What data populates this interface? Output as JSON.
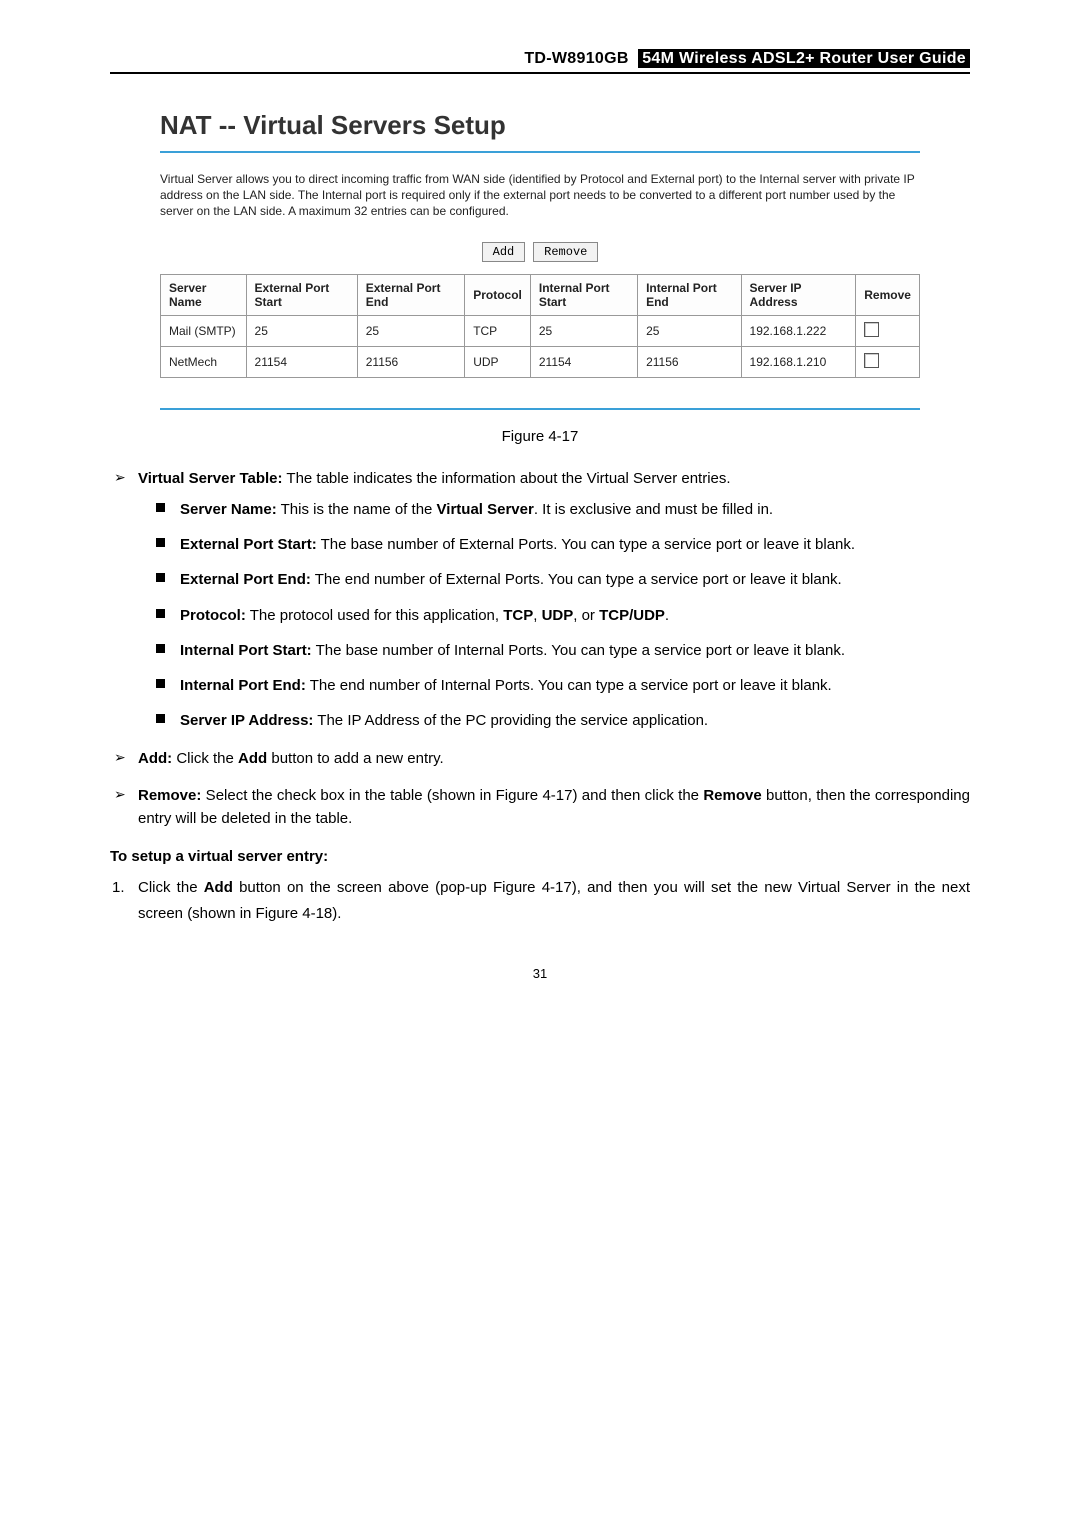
{
  "header": {
    "model": "TD-W8910GB",
    "title": "54M Wireless ADSL2+ Router User Guide"
  },
  "router": {
    "heading": "NAT -- Virtual Servers Setup",
    "description": "Virtual Server allows you to direct incoming traffic from WAN side (identified by Protocol and External port) to the Internal server with private IP address on the LAN side. The Internal port is required only if the external port needs to be converted to a different port number used by the server on the LAN side. A maximum 32 entries can be configured.",
    "buttons": {
      "add": "Add",
      "remove": "Remove"
    },
    "columns": {
      "c0": "Server Name",
      "c1": "External Port Start",
      "c2": "External Port End",
      "c3": "Protocol",
      "c4": "Internal Port Start",
      "c5": "Internal Port End",
      "c6": "Server IP Address",
      "c7": "Remove"
    },
    "rows": [
      {
        "c0": "Mail (SMTP)",
        "c1": "25",
        "c2": "25",
        "c3": "TCP",
        "c4": "25",
        "c5": "25",
        "c6": "192.168.1.222"
      },
      {
        "c0": "NetMech",
        "c1": "21154",
        "c2": "21156",
        "c3": "UDP",
        "c4": "21154",
        "c5": "21156",
        "c6": "192.168.1.210"
      }
    ]
  },
  "figure_caption": "Figure 4-17",
  "doc": {
    "vs_table_label": "Virtual Server Table:",
    "vs_table_text": " The table indicates the information about the Virtual Server entries.",
    "server_name_label": "Server Name:",
    "server_name_text_a": " This is the name of the ",
    "server_name_bold": "Virtual Server",
    "server_name_text_b": ". It is exclusive and must be filled in.",
    "ext_start_label": "External Port Start:",
    "ext_start_text": " The base number of External Ports. You can type a service port or leave it blank.",
    "ext_end_label": "External Port End:",
    "ext_end_text": " The end number of External Ports. You can type a service port or leave it blank.",
    "protocol_label": "Protocol:",
    "protocol_text_a": " The protocol used for this application, ",
    "protocol_tcp": "TCP",
    "protocol_sep1": ", ",
    "protocol_udp": "UDP",
    "protocol_sep2": ", or ",
    "protocol_both": "TCP/UDP",
    "protocol_end": ".",
    "int_start_label": "Internal Port Start:",
    "int_start_text": " The base number of Internal Ports. You can type a service port or leave it blank.",
    "int_end_label": "Internal Port End:",
    "int_end_text": " The end number of Internal Ports. You can type a service port or leave it blank.",
    "server_ip_label": "Server IP Address:",
    "server_ip_text": " The IP Address of the PC providing the service application.",
    "add_label": "Add:",
    "add_text_a": " Click the ",
    "add_bold": "Add",
    "add_text_b": " button to add a new entry.",
    "remove_label": "Remove:",
    "remove_text_a": " Select the check box in the table (shown in Figure 4-17) and then click the ",
    "remove_bold": "Remove",
    "remove_text_b": " button, then the corresponding entry will be deleted in the table.",
    "setup_heading": "To setup a virtual server entry:",
    "step1_a": "Click the ",
    "step1_bold": "Add",
    "step1_b": " button on the screen above (pop-up Figure 4-17), and then you will set the new Virtual Server in the next screen (shown in Figure 4-18)."
  },
  "page_number": "31"
}
